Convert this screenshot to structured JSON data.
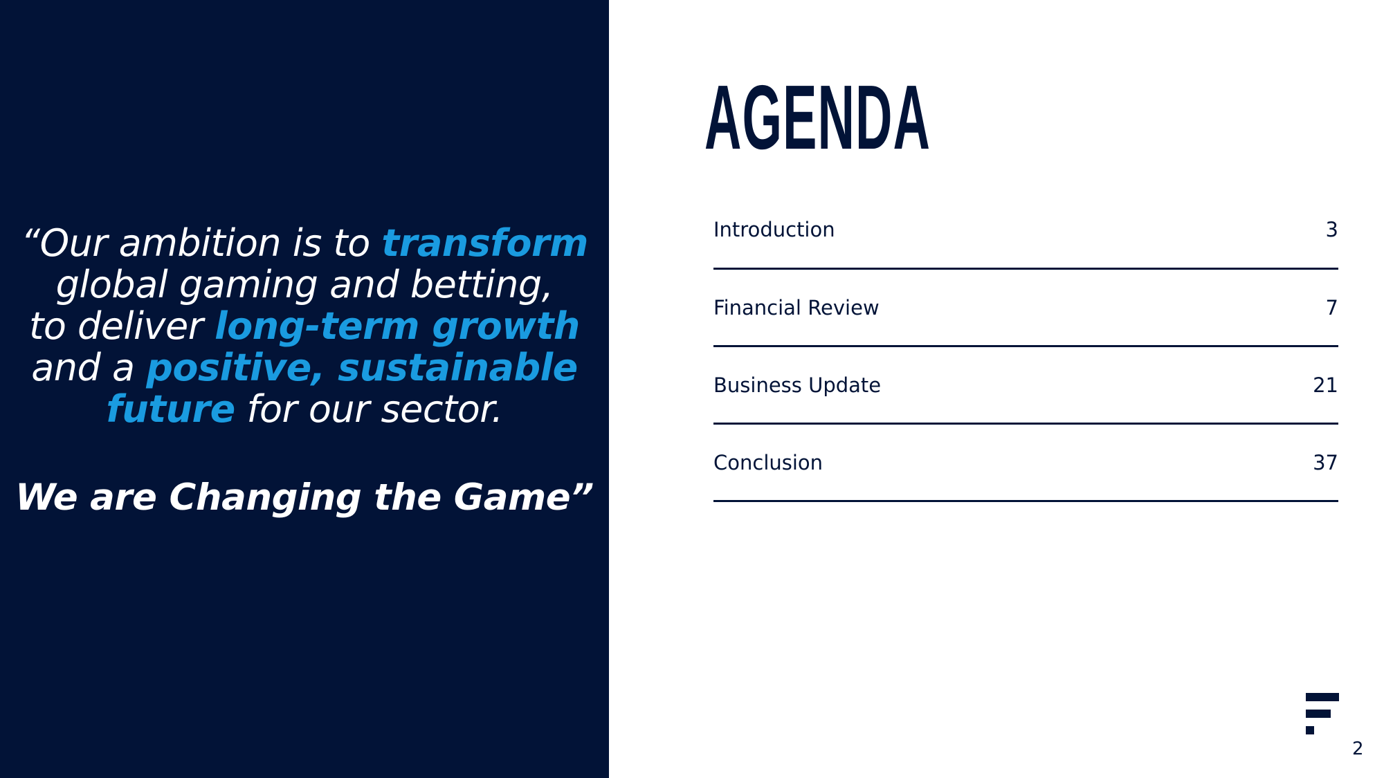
{
  "quote": {
    "line1_a": "“Our ambition is to ",
    "line1_b": "transform",
    "line2": "global gaming and betting,",
    "line3_a": "to deliver ",
    "line3_b": "long-term growth",
    "line4_a": "and a ",
    "line4_b": "positive, sustainable",
    "line5_a": "future",
    "line5_b": " for our sector.",
    "tagline": "We are Changing the Game”"
  },
  "title": "AGENDA",
  "agenda": [
    {
      "label": "Introduction",
      "page": "3"
    },
    {
      "label": "Financial Review",
      "page": "7"
    },
    {
      "label": "Business Update",
      "page": "21"
    },
    {
      "label": "Conclusion",
      "page": "37"
    }
  ],
  "colors": {
    "navy": "#021337",
    "accent": "#1a9be0"
  },
  "logo": {
    "icon": "company-logo-f-icon"
  },
  "page_number": "2"
}
